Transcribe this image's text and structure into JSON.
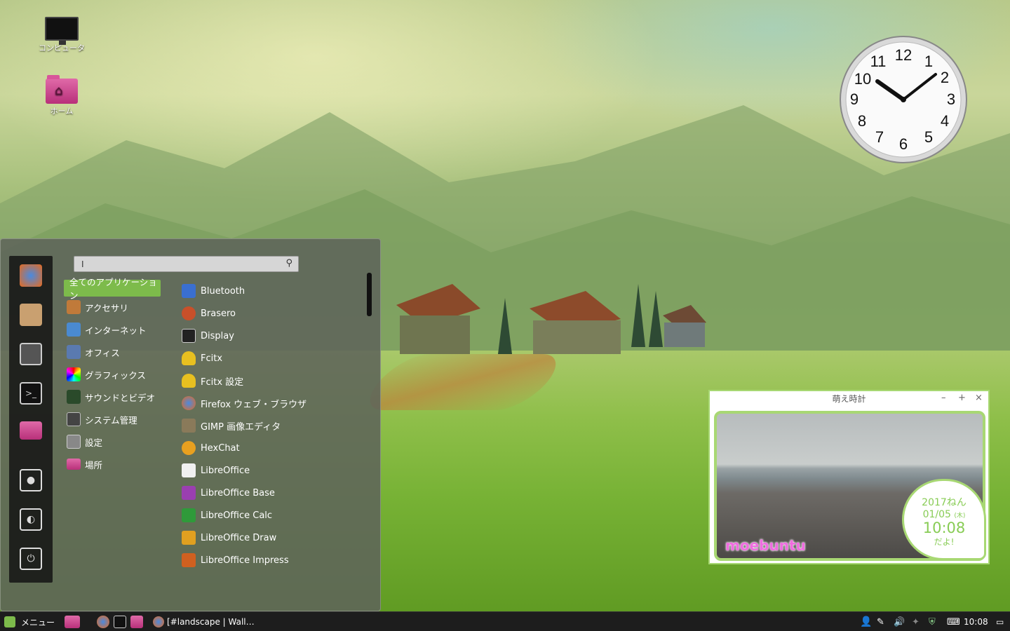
{
  "desktop": {
    "icons": [
      {
        "label": "コンピュータ",
        "icon": "computer-icon"
      },
      {
        "label": "ホーム",
        "icon": "home-folder-icon"
      }
    ]
  },
  "clock_widget": {
    "time_display": "10:08"
  },
  "menu": {
    "search_placeholder": "",
    "search_value": "I",
    "favorites": [
      "firefox-icon",
      "package-icon",
      "settings-icon",
      "terminal-icon",
      "folder-icon",
      "lock-icon",
      "logout-icon",
      "power-icon"
    ],
    "categories": [
      {
        "label": "全てのアプリケーション",
        "active": true
      },
      {
        "label": "アクセサリ"
      },
      {
        "label": "インターネット"
      },
      {
        "label": "オフィス"
      },
      {
        "label": "グラフィックス"
      },
      {
        "label": "サウンドとビデオ"
      },
      {
        "label": "システム管理"
      },
      {
        "label": "設定"
      },
      {
        "label": "場所"
      }
    ],
    "apps": [
      {
        "label": "Bluetooth",
        "color": "#3a6fd0"
      },
      {
        "label": "Brasero",
        "color": "#c8502a"
      },
      {
        "label": "Display",
        "color": "#222222"
      },
      {
        "label": "Fcitx",
        "color": "#e8c020"
      },
      {
        "label": "Fcitx 設定",
        "color": "#e8c020"
      },
      {
        "label": "Firefox ウェブ・ブラウザ",
        "color": "#e66a1e"
      },
      {
        "label": "GIMP 画像エディタ",
        "color": "#8a7a5a"
      },
      {
        "label": "HexChat",
        "color": "#e8a020"
      },
      {
        "label": "LibreOffice",
        "color": "#f0f0f0"
      },
      {
        "label": "LibreOffice Base",
        "color": "#9a3fb0"
      },
      {
        "label": "LibreOffice Calc",
        "color": "#2f9a3a"
      },
      {
        "label": "LibreOffice Draw",
        "color": "#e0a020"
      },
      {
        "label": "LibreOffice Impress",
        "color": "#d06020"
      }
    ]
  },
  "moe_clock": {
    "title": "萌え時計",
    "minimize": "–",
    "maximize": "+",
    "close": "×",
    "logo": "moebuntu",
    "year": "2017ねん",
    "date": "01/05",
    "weekday": "(木)",
    "time": "10:08",
    "suffix": "だよ!"
  },
  "taskbar": {
    "menu_label": "メニュー",
    "window_title": "[#landscape | Wall…",
    "time": "10:08"
  }
}
